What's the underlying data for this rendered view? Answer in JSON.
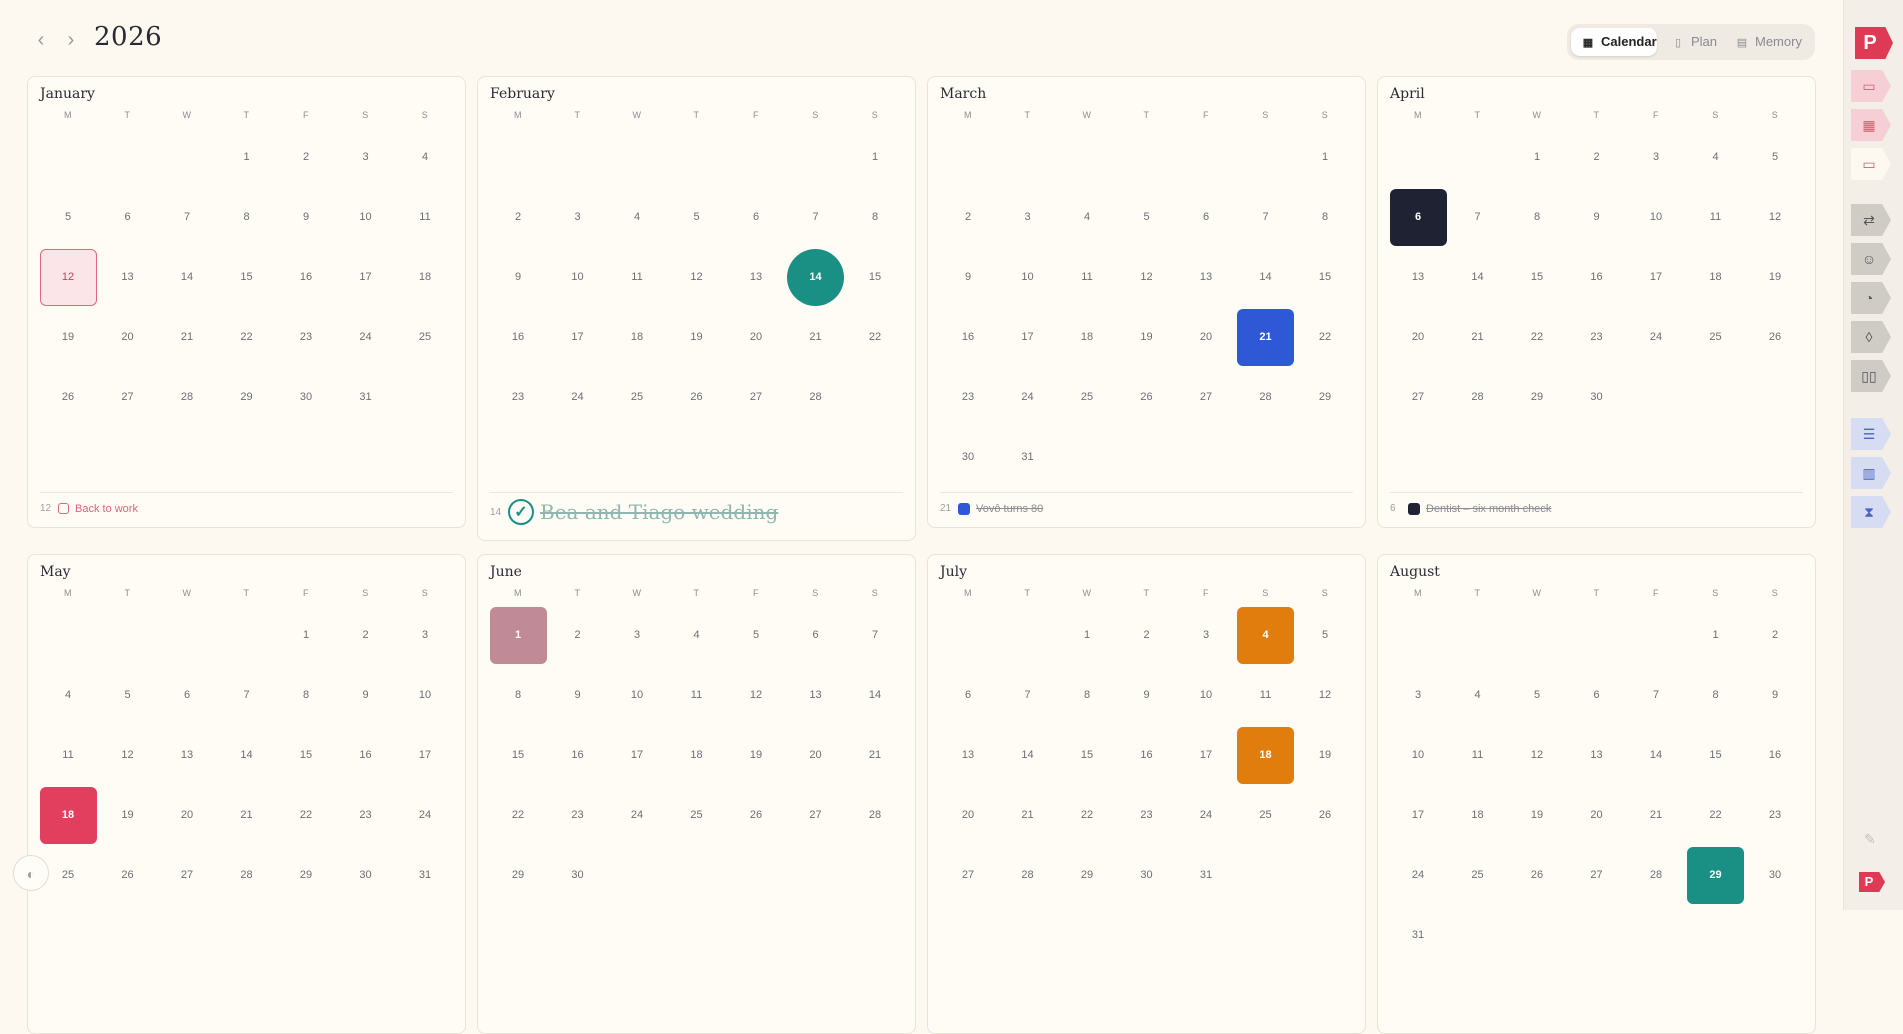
{
  "header": {
    "prev_label": "‹",
    "next_label": "›",
    "year": "2026",
    "views": [
      {
        "label": "Calendar",
        "icon": "calendar-grid-icon",
        "active": true
      },
      {
        "label": "Plan",
        "icon": "plan-book-icon",
        "active": false
      },
      {
        "label": "Memory",
        "icon": "memory-cards-icon",
        "active": false
      }
    ]
  },
  "weekdays": [
    "M",
    "T",
    "W",
    "T",
    "F",
    "S",
    "S"
  ],
  "months": [
    {
      "name": "January",
      "offset": 3,
      "days": 31,
      "marks": [
        {
          "day": 12,
          "style": "outline",
          "color": "#e1677b"
        }
      ],
      "event": {
        "day": "12",
        "kind": "checkbox",
        "color": "#e0637a",
        "text": "Back to work",
        "done": false
      }
    },
    {
      "name": "February",
      "offset": 6,
      "days": 28,
      "marks": [
        {
          "day": 14,
          "style": "circle",
          "color": "#1a8f84"
        }
      ],
      "event": {
        "day": "14",
        "kind": "check",
        "color": "#1a8f84",
        "text": "Bea and Tiago wedding",
        "done": true
      }
    },
    {
      "name": "March",
      "offset": 6,
      "days": 31,
      "marks": [
        {
          "day": 21,
          "style": "square",
          "color": "#2f58d6"
        }
      ],
      "event": {
        "day": "21",
        "kind": "square",
        "color": "#2f58d6",
        "text": "Vovô turns 80",
        "done": true
      }
    },
    {
      "name": "April",
      "offset": 2,
      "days": 30,
      "marks": [
        {
          "day": 6,
          "style": "square",
          "color": "#1e2233"
        }
      ],
      "event": {
        "day": "6",
        "kind": "square",
        "color": "#1e2233",
        "text": "Dentist – six month check",
        "done": true
      }
    },
    {
      "name": "May",
      "offset": 4,
      "days": 31,
      "marks": [
        {
          "day": 18,
          "style": "square",
          "color": "#e23e5d"
        }
      ]
    },
    {
      "name": "June",
      "offset": 0,
      "days": 30,
      "marks": [
        {
          "day": 1,
          "style": "square",
          "color": "#c08a96"
        }
      ]
    },
    {
      "name": "July",
      "offset": 2,
      "days": 31,
      "marks": [
        {
          "day": 4,
          "style": "square",
          "color": "#e07d0d"
        },
        {
          "day": 18,
          "style": "square",
          "color": "#e07d0d"
        }
      ]
    },
    {
      "name": "August",
      "offset": 5,
      "days": 31,
      "marks": [
        {
          "day": 29,
          "style": "square",
          "color": "#1a8f84"
        }
      ]
    }
  ],
  "sidebar": {
    "logo_letter": "P",
    "tabs": [
      {
        "icon": "calendar-day-icon",
        "glyph": "▭",
        "bg": "#f5cfd5",
        "fg": "#e1566d"
      },
      {
        "icon": "calendar-month-icon",
        "glyph": "▦",
        "bg": "#f5cfd5",
        "fg": "#e1566d"
      },
      {
        "icon": "calendar-year-icon",
        "glyph": "▭",
        "bg": "#fdf8f0",
        "fg": "#e1566d"
      },
      {
        "icon": "repeat-icon",
        "glyph": "⇄",
        "bg": "#cfccc6",
        "fg": "#55555a"
      },
      {
        "icon": "mood-face-icon",
        "glyph": "☺",
        "bg": "#cfccc6",
        "fg": "#55555a"
      },
      {
        "icon": "palette-icon",
        "glyph": "◔",
        "bg": "#cfccc6",
        "fg": "#55555a"
      },
      {
        "icon": "water-drop-icon",
        "glyph": "◊",
        "bg": "#cfccc6",
        "fg": "#55555a"
      },
      {
        "icon": "tracker-bars-icon",
        "glyph": "▯▯",
        "bg": "#cfccc6",
        "fg": "#55555a"
      },
      {
        "icon": "checklist-icon",
        "glyph": "☰",
        "bg": "#d6dcf2",
        "fg": "#4a64c4"
      },
      {
        "icon": "books-icon",
        "glyph": "▥",
        "bg": "#d6dcf2",
        "fg": "#4a64c4"
      },
      {
        "icon": "hourglass-icon",
        "glyph": "⧗",
        "bg": "#d6dcf2",
        "fg": "#4a64c4"
      }
    ],
    "pencil_glyph": "✎"
  },
  "palette_glyph": "◐"
}
